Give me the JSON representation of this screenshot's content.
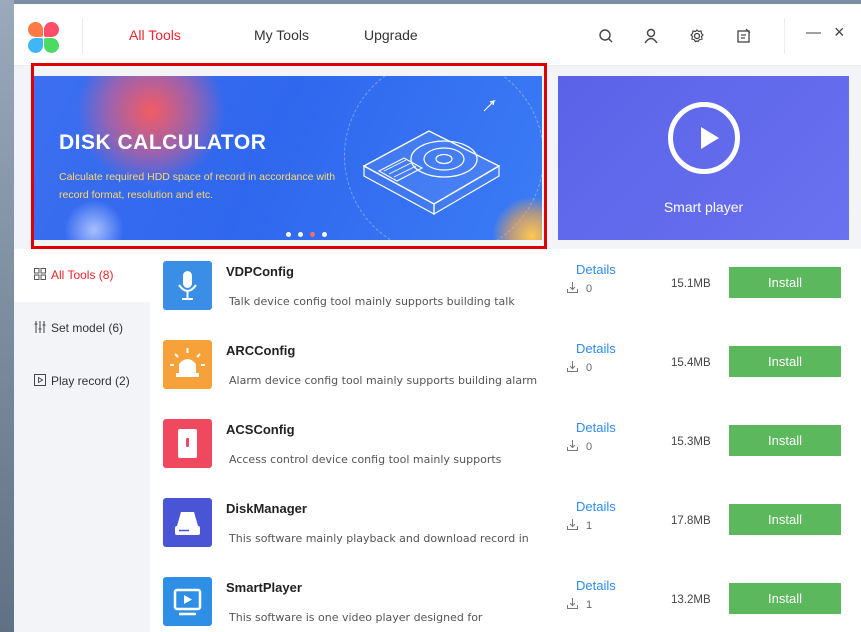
{
  "nav": {
    "tabs": [
      {
        "label": "All Tools",
        "active": true
      },
      {
        "label": "My Tools",
        "active": false
      },
      {
        "label": "Upgrade",
        "active": false
      }
    ],
    "icons": [
      "search-icon",
      "user-icon",
      "gear-icon",
      "notes-icon",
      "minimize-icon",
      "close-icon"
    ],
    "minimize": "—",
    "close": "×"
  },
  "banner": {
    "title": "DISK CALCULATOR",
    "description": "Calculate required HDD space of record in accordance with record format, resolution and etc.",
    "dots": 4,
    "active_dot": 2
  },
  "player": {
    "label": "Smart player"
  },
  "sidebar": {
    "items": [
      {
        "label": "All Tools (8)",
        "icon": "grid-icon",
        "active": true
      },
      {
        "label": "Set model (6)",
        "icon": "sliders-icon",
        "active": false
      },
      {
        "label": "Play record (2)",
        "icon": "play-record-icon",
        "active": false
      }
    ]
  },
  "tools": [
    {
      "name": "VDPConfig",
      "desc": "Talk device config tool mainly supports building talk",
      "details": "Details",
      "downloads": "0",
      "size": "15.1MB",
      "install": "Install",
      "icon": "microphone-icon",
      "color": "#3a8ee6"
    },
    {
      "name": "ARCConfig",
      "desc": "Alarm device config tool mainly supports building alarm",
      "details": "Details",
      "downloads": "0",
      "size": "15.4MB",
      "install": "Install",
      "icon": "alarm-icon",
      "color": "#f7a13a"
    },
    {
      "name": "ACSConfig",
      "desc": "Access control device config tool mainly supports",
      "details": "Details",
      "downloads": "0",
      "size": "15.3MB",
      "install": "Install",
      "icon": "door-icon",
      "color": "#f0485e"
    },
    {
      "name": "DiskManager",
      "desc": "This software mainly playback and download record in",
      "details": "Details",
      "downloads": "1",
      "size": "17.8MB",
      "install": "Install",
      "icon": "disk-icon",
      "color": "#4a55d6"
    },
    {
      "name": "SmartPlayer",
      "desc": "This software is one video player designed for",
      "details": "Details",
      "downloads": "1",
      "size": "13.2MB",
      "install": "Install",
      "icon": "player-icon",
      "color": "#2f8fe6"
    }
  ],
  "colors": {
    "accent_red": "#f5222d",
    "link_blue": "#2d8cf0",
    "install_green": "#5cb85c"
  }
}
